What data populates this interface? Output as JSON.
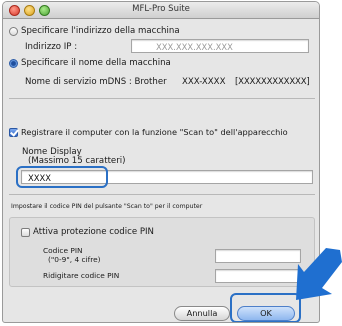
{
  "window": {
    "title": "MFL-Pro Suite"
  },
  "ip_option": {
    "label": "Specificare l'indirizzo della macchina",
    "ip_label": "Indirizzo IP :",
    "ip_value": "XXX.XXX.XXX.XXX",
    "selected": false
  },
  "name_option": {
    "label": "Specificare il nome della macchina",
    "service_label": "Nome di servizio mDNS : Brother",
    "service_name": "XXX-XXXX",
    "service_id": "[XXXXXXXXXXXX]",
    "selected": true
  },
  "scan_register": {
    "label": "Registrare il computer con la funzione \"Scan to\" dell'apparecchio",
    "checked": true
  },
  "display_name": {
    "label": "Nome Display",
    "hint": "(Massimo 15 caratteri)",
    "value": "XXXX"
  },
  "pin_section": {
    "heading": "Impostare il codice PIN del pulsante \"Scan to\" per il computer",
    "protect_label": "Attiva protezione codice PIN",
    "protect_checked": false,
    "pin_label": "Codice PIN",
    "pin_hint": "(\"0-9\", 4 cifre)",
    "pin_value": "",
    "retype_label": "Ridigitare codice PIN",
    "retype_value": ""
  },
  "buttons": {
    "cancel": "Annulla",
    "ok": "OK"
  },
  "colors": {
    "highlight": "#2b70c5",
    "arrow": "#1f6fd0"
  },
  "icons": [
    "close-window-icon",
    "minimize-window-icon",
    "zoom-window-icon",
    "pointer-arrow-icon"
  ]
}
